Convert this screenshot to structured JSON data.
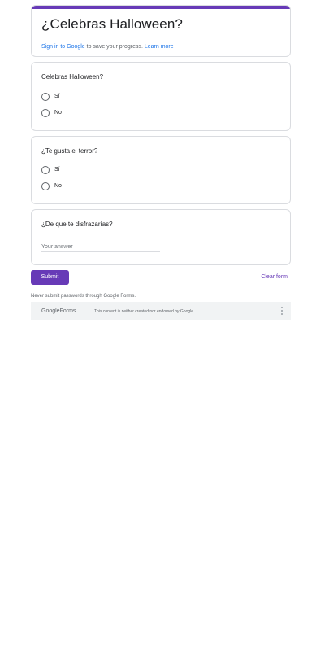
{
  "form": {
    "title": "¿Celebras Halloween?",
    "signin_link": "Sign in to Google",
    "signin_text": " to save your progress. ",
    "learn_more": "Learn more",
    "accent_color": "#673ab7"
  },
  "questions": [
    {
      "title": "Celebras Halloween?",
      "type": "radio",
      "options": [
        "Sí",
        "No"
      ]
    },
    {
      "title": "¿Te gusta el terror?",
      "type": "radio",
      "options": [
        "Sí",
        "No"
      ]
    },
    {
      "title": "¿De que te disfrazarías?",
      "type": "text",
      "placeholder": "Your answer"
    }
  ],
  "actions": {
    "submit_label": "Submit",
    "clear_label": "Clear form"
  },
  "footer": {
    "password_note": "Never submit passwords through Google Forms.",
    "logo_google": "Google",
    "logo_forms": "Forms",
    "disclaimer": "This content is neither created nor endorsed by Google.",
    "menu_icon": "more-vert-icon"
  }
}
